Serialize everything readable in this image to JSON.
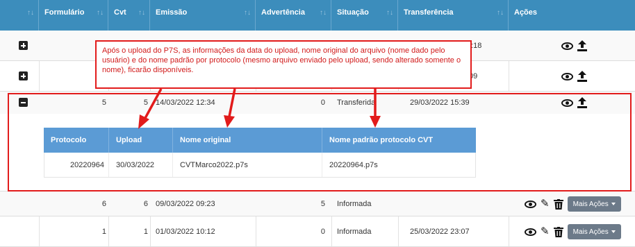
{
  "table": {
    "headers": [
      {
        "label": "",
        "sort": "↑↓"
      },
      {
        "label": "Formulário",
        "sort": "↑↓"
      },
      {
        "label": "Cvt",
        "sort": "↑↓"
      },
      {
        "label": "Emissão",
        "sort": "↑↓"
      },
      {
        "label": "Advertência",
        "sort": "↑↓"
      },
      {
        "label": "Situação",
        "sort": "↑↓"
      },
      {
        "label": "Transferência",
        "sort": "↑↓"
      },
      {
        "label": "Ações",
        "sort": ""
      }
    ],
    "rows": [
      {
        "expanded": false,
        "formulario": "",
        "cvt": "",
        "emissao": "",
        "advertencia": "",
        "situacao": "",
        "transferencia": "5:18",
        "actions": [
          "view",
          "upload"
        ]
      },
      {
        "expanded": false,
        "formulario": "",
        "cvt": "",
        "emissao": "",
        "advertencia": "",
        "situacao": "",
        "transferencia": ":09",
        "actions": [
          "view",
          "upload"
        ]
      },
      {
        "expanded": true,
        "formulario": "5",
        "cvt": "5",
        "emissao": "14/03/2022 12:34",
        "advertencia": "0",
        "situacao": "Transferida",
        "transferencia": "29/03/2022 15:39",
        "actions": [
          "view",
          "upload"
        ]
      },
      {
        "expanded": false,
        "formulario": "6",
        "cvt": "6",
        "emissao": "09/03/2022 09:23",
        "advertencia": "5",
        "situacao": "Informada",
        "transferencia": "",
        "actions": [
          "view",
          "edit",
          "delete",
          "more"
        ]
      },
      {
        "expanded": false,
        "formulario": "1",
        "cvt": "1",
        "emissao": "01/03/2022 10:12",
        "advertencia": "0",
        "situacao": "Informada",
        "transferencia": "25/03/2022 23:07",
        "actions": [
          "view",
          "edit",
          "delete",
          "more"
        ]
      }
    ],
    "more_actions_label": "Mais Ações"
  },
  "subtable": {
    "headers": [
      "Protocolo",
      "Upload",
      "Nome original",
      "Nome padrão protocolo CVT"
    ],
    "row": {
      "protocolo": "20220964",
      "upload": "30/03/2022",
      "nome_original": "CVTMarco2022.p7s",
      "nome_padrao": "20220964.p7s"
    }
  },
  "annotation": {
    "text": "Após o upload do P7S, as informações da data do upload, nome original do arquivo (nome dado pelo usuário) e do nome padrão por protocolo (mesmo arquivo enviado pelo upload, sendo alterado somente o nome), ficarão disponíveis."
  },
  "colors": {
    "header": "#3c8dbc",
    "subheader": "#5b9bd5",
    "annotation": "#e21b1b",
    "button": "#6c7a89"
  },
  "icons": [
    "plus-square-icon",
    "minus-square-icon",
    "eye-icon",
    "upload-icon",
    "pencil-icon",
    "trash-icon",
    "caret-down-icon"
  ]
}
